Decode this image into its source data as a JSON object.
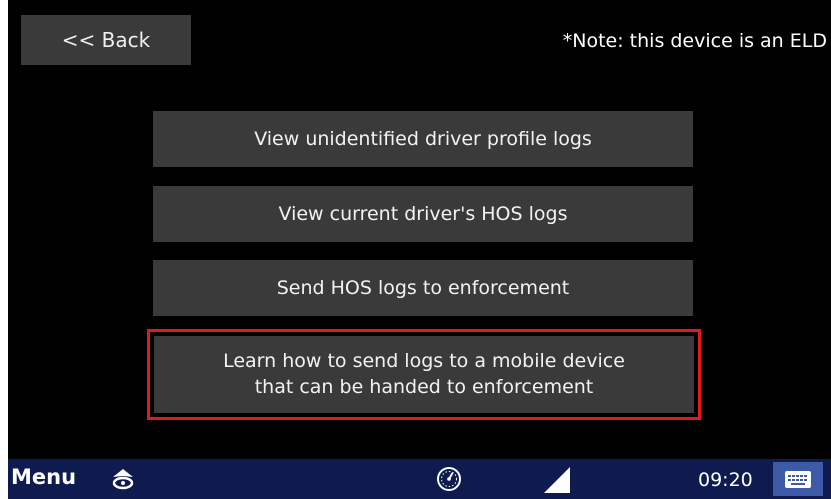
{
  "header": {
    "back_label": "<< Back",
    "note": "*Note: this device is an ELD"
  },
  "menu": {
    "items": [
      {
        "label": "View unidentified driver profile logs"
      },
      {
        "label": "View current driver's HOS logs"
      },
      {
        "label": "Send HOS logs to enforcement"
      },
      {
        "line1": "Learn how to send logs to a mobile device",
        "line2": "that can be handed to enforcement",
        "highlight_color": "#e3191f"
      }
    ]
  },
  "taskbar": {
    "menu_label": "Menu",
    "time": "09:20",
    "icons": [
      "gps-icon",
      "gauge-icon",
      "signal-icon",
      "keyboard-icon"
    ]
  },
  "colors": {
    "background": "#000000",
    "button": "#3a3a3a",
    "taskbar": "#0f1b4f",
    "keyboard_button": "#3c5aa5"
  }
}
